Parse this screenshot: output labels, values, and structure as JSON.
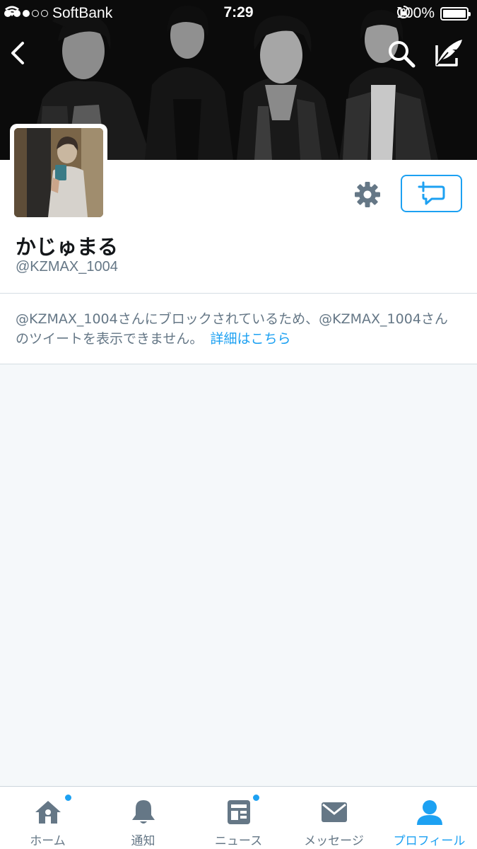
{
  "status_bar": {
    "carrier": "SoftBank",
    "time": "7:29",
    "battery_percent": "100%",
    "signal_bars_filled": 3,
    "signal_bars_total": 5
  },
  "profile": {
    "display_name": "かじゅまる",
    "screen_name": "@KZMAX_1004"
  },
  "blocked_notice": {
    "message": "@KZMAX_1004さんにブロックされているため、@KZMAX_1004さんのツイートを表示できません。",
    "learn_more": "詳細はこちら"
  },
  "tab_bar": {
    "tabs": [
      {
        "label": "ホーム",
        "icon": "home-icon",
        "active": false,
        "badge": true
      },
      {
        "label": "通知",
        "icon": "bell-icon",
        "active": false,
        "badge": false
      },
      {
        "label": "ニュース",
        "icon": "news-icon",
        "active": false,
        "badge": true
      },
      {
        "label": "メッセージ",
        "icon": "envelope-icon",
        "active": false,
        "badge": false
      },
      {
        "label": "プロフィール",
        "icon": "person-icon",
        "active": true,
        "badge": false
      }
    ]
  },
  "colors": {
    "accent": "#1da1f2",
    "muted_text": "#657786",
    "icon_gray": "#657786",
    "background": "#f5f8fa"
  }
}
